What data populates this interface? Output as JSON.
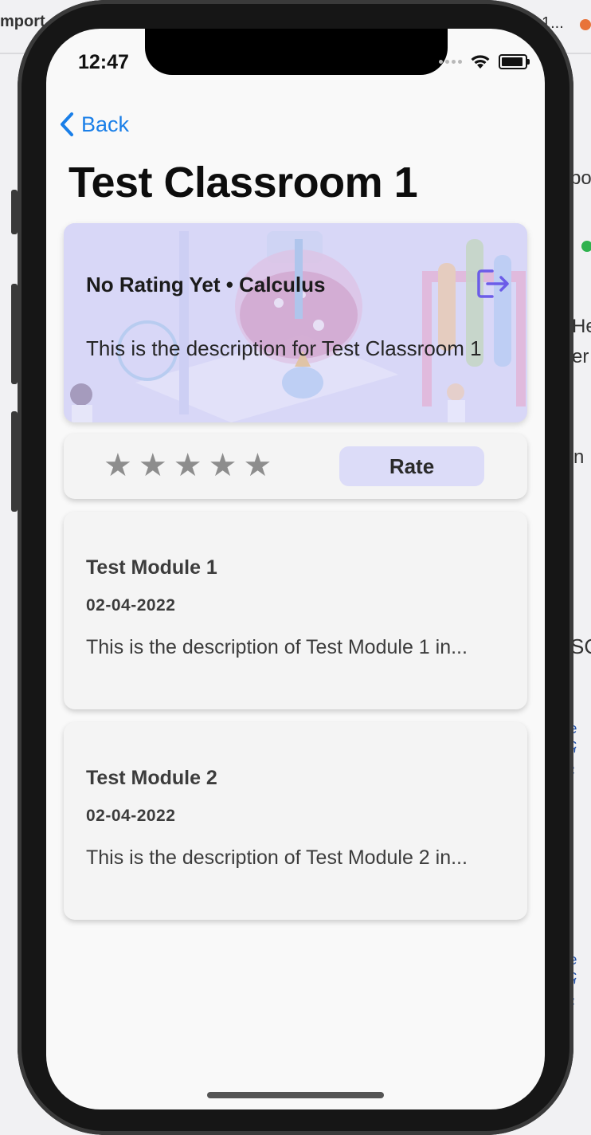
{
  "background": {
    "fragments": [
      "mport",
      "1...",
      "po",
      "He",
      "er",
      "n",
      "SC",
      "e c",
      "\" ;",
      "e c",
      "\" ;"
    ]
  },
  "status_bar": {
    "time": "12:47"
  },
  "nav": {
    "back_label": "Back"
  },
  "page": {
    "title": "Test Classroom 1"
  },
  "classroom": {
    "meta": "No Rating Yet • Calculus",
    "description": "This is the description for Test Classroom 1",
    "exit_icon": "exit-icon"
  },
  "rating": {
    "stars": [
      "★",
      "★",
      "★",
      "★",
      "★"
    ],
    "current": 0,
    "button_label": "Rate"
  },
  "modules": [
    {
      "title": "Test Module 1",
      "date": "02-04-2022",
      "description": "This is the description of Test Module 1 in..."
    },
    {
      "title": "Test Module 2",
      "date": "02-04-2022",
      "description": "This is the description of Test Module 2 in..."
    }
  ],
  "colors": {
    "accent": "#1a7fe8",
    "rate_button": "#dcdcf8",
    "exit_icon": "#6b5ce8",
    "star": "#8d8d8d"
  }
}
